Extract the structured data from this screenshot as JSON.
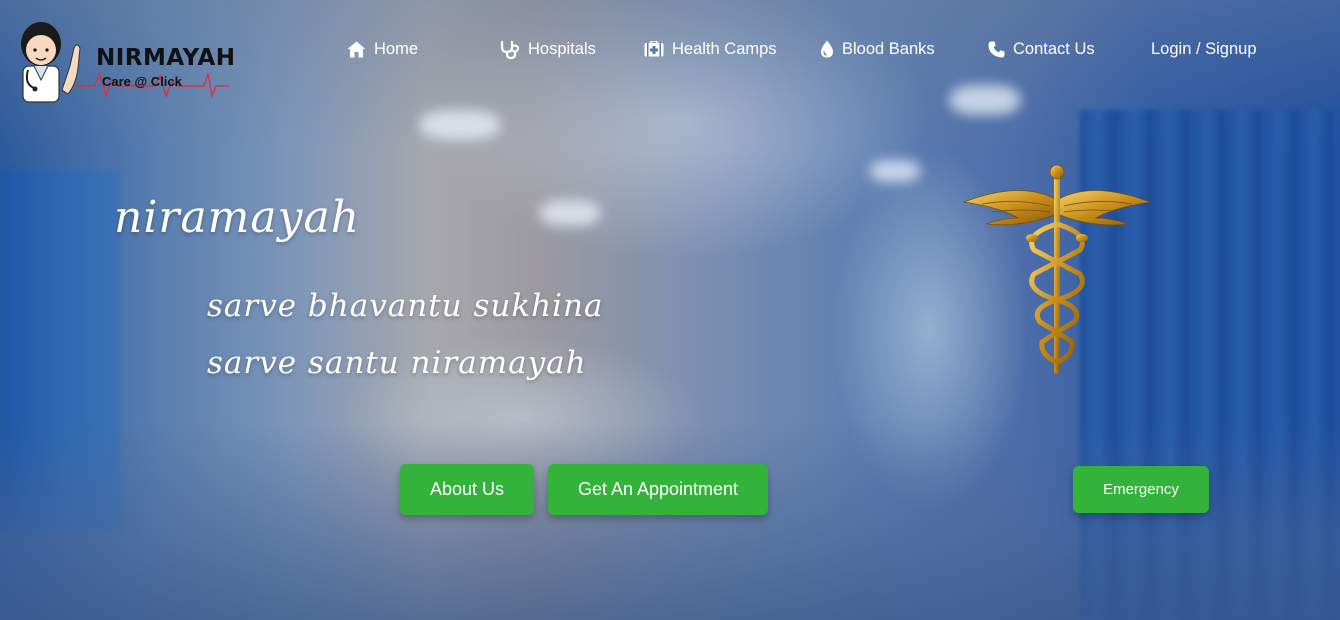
{
  "brand": {
    "name": "NIRMAYAH",
    "tagline": "Care @ Click"
  },
  "nav": {
    "items": [
      {
        "label": "Home",
        "icon": "home-icon"
      },
      {
        "label": "Hospitals",
        "icon": "stethoscope-icon"
      },
      {
        "label": "Health Camps",
        "icon": "first-aid-kit-icon"
      },
      {
        "label": "Blood Banks",
        "icon": "blood-drop-icon"
      },
      {
        "label": "Contact Us",
        "icon": "phone-icon"
      },
      {
        "label": "Login / Signup",
        "icon": ""
      }
    ]
  },
  "hero": {
    "title": "niramayah",
    "line1": "sarve bhavantu sukhina",
    "line2": "sarve santu niramayah"
  },
  "buttons": {
    "about": "About Us",
    "appointment": "Get An Appointment",
    "emergency": "Emergency"
  },
  "colors": {
    "button_green": "#33b33a",
    "nav_text": "#ffffff",
    "caduceus_gold": "#d9a72a",
    "heartbeat_red": "#d3344a"
  }
}
